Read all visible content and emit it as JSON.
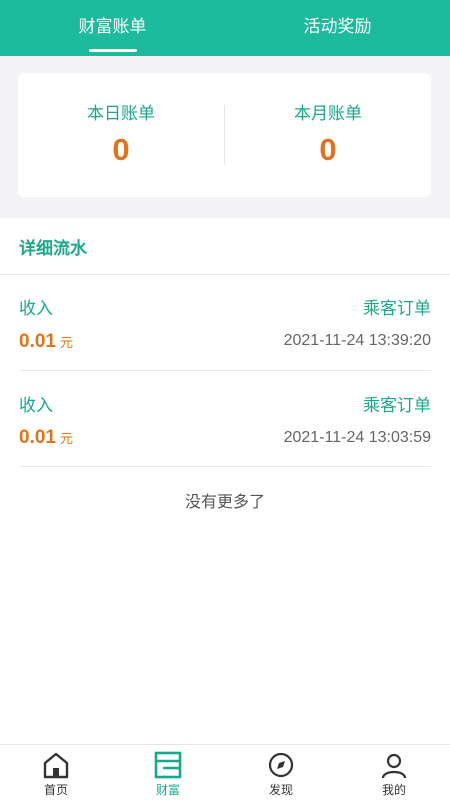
{
  "tabs": [
    {
      "label": "财富账单",
      "active": true
    },
    {
      "label": "活动奖励",
      "active": false
    }
  ],
  "summary": {
    "today_label": "本日账单",
    "today_value": "0",
    "month_label": "本月账单",
    "month_value": "0"
  },
  "detail": {
    "title": "详细流水",
    "records": [
      {
        "type": "收入",
        "source": "乘客订单",
        "amount": "0.01",
        "unit": "元",
        "time": "2021-11-24 13:39:20"
      },
      {
        "type": "收入",
        "source": "乘客订单",
        "amount": "0.01",
        "unit": "元",
        "time": "2021-11-24 13:03:59"
      }
    ],
    "no_more": "没有更多了"
  },
  "nav": [
    {
      "label": "首页",
      "icon": "home-icon",
      "active": false
    },
    {
      "label": "财富",
      "icon": "wallet-icon",
      "active": true
    },
    {
      "label": "发现",
      "icon": "compass-icon",
      "active": false
    },
    {
      "label": "我的",
      "icon": "user-icon",
      "active": false
    }
  ],
  "colors": {
    "brand": "#1dbb9d",
    "accent_text": "#1aa88d",
    "amount": "#e3731a"
  }
}
